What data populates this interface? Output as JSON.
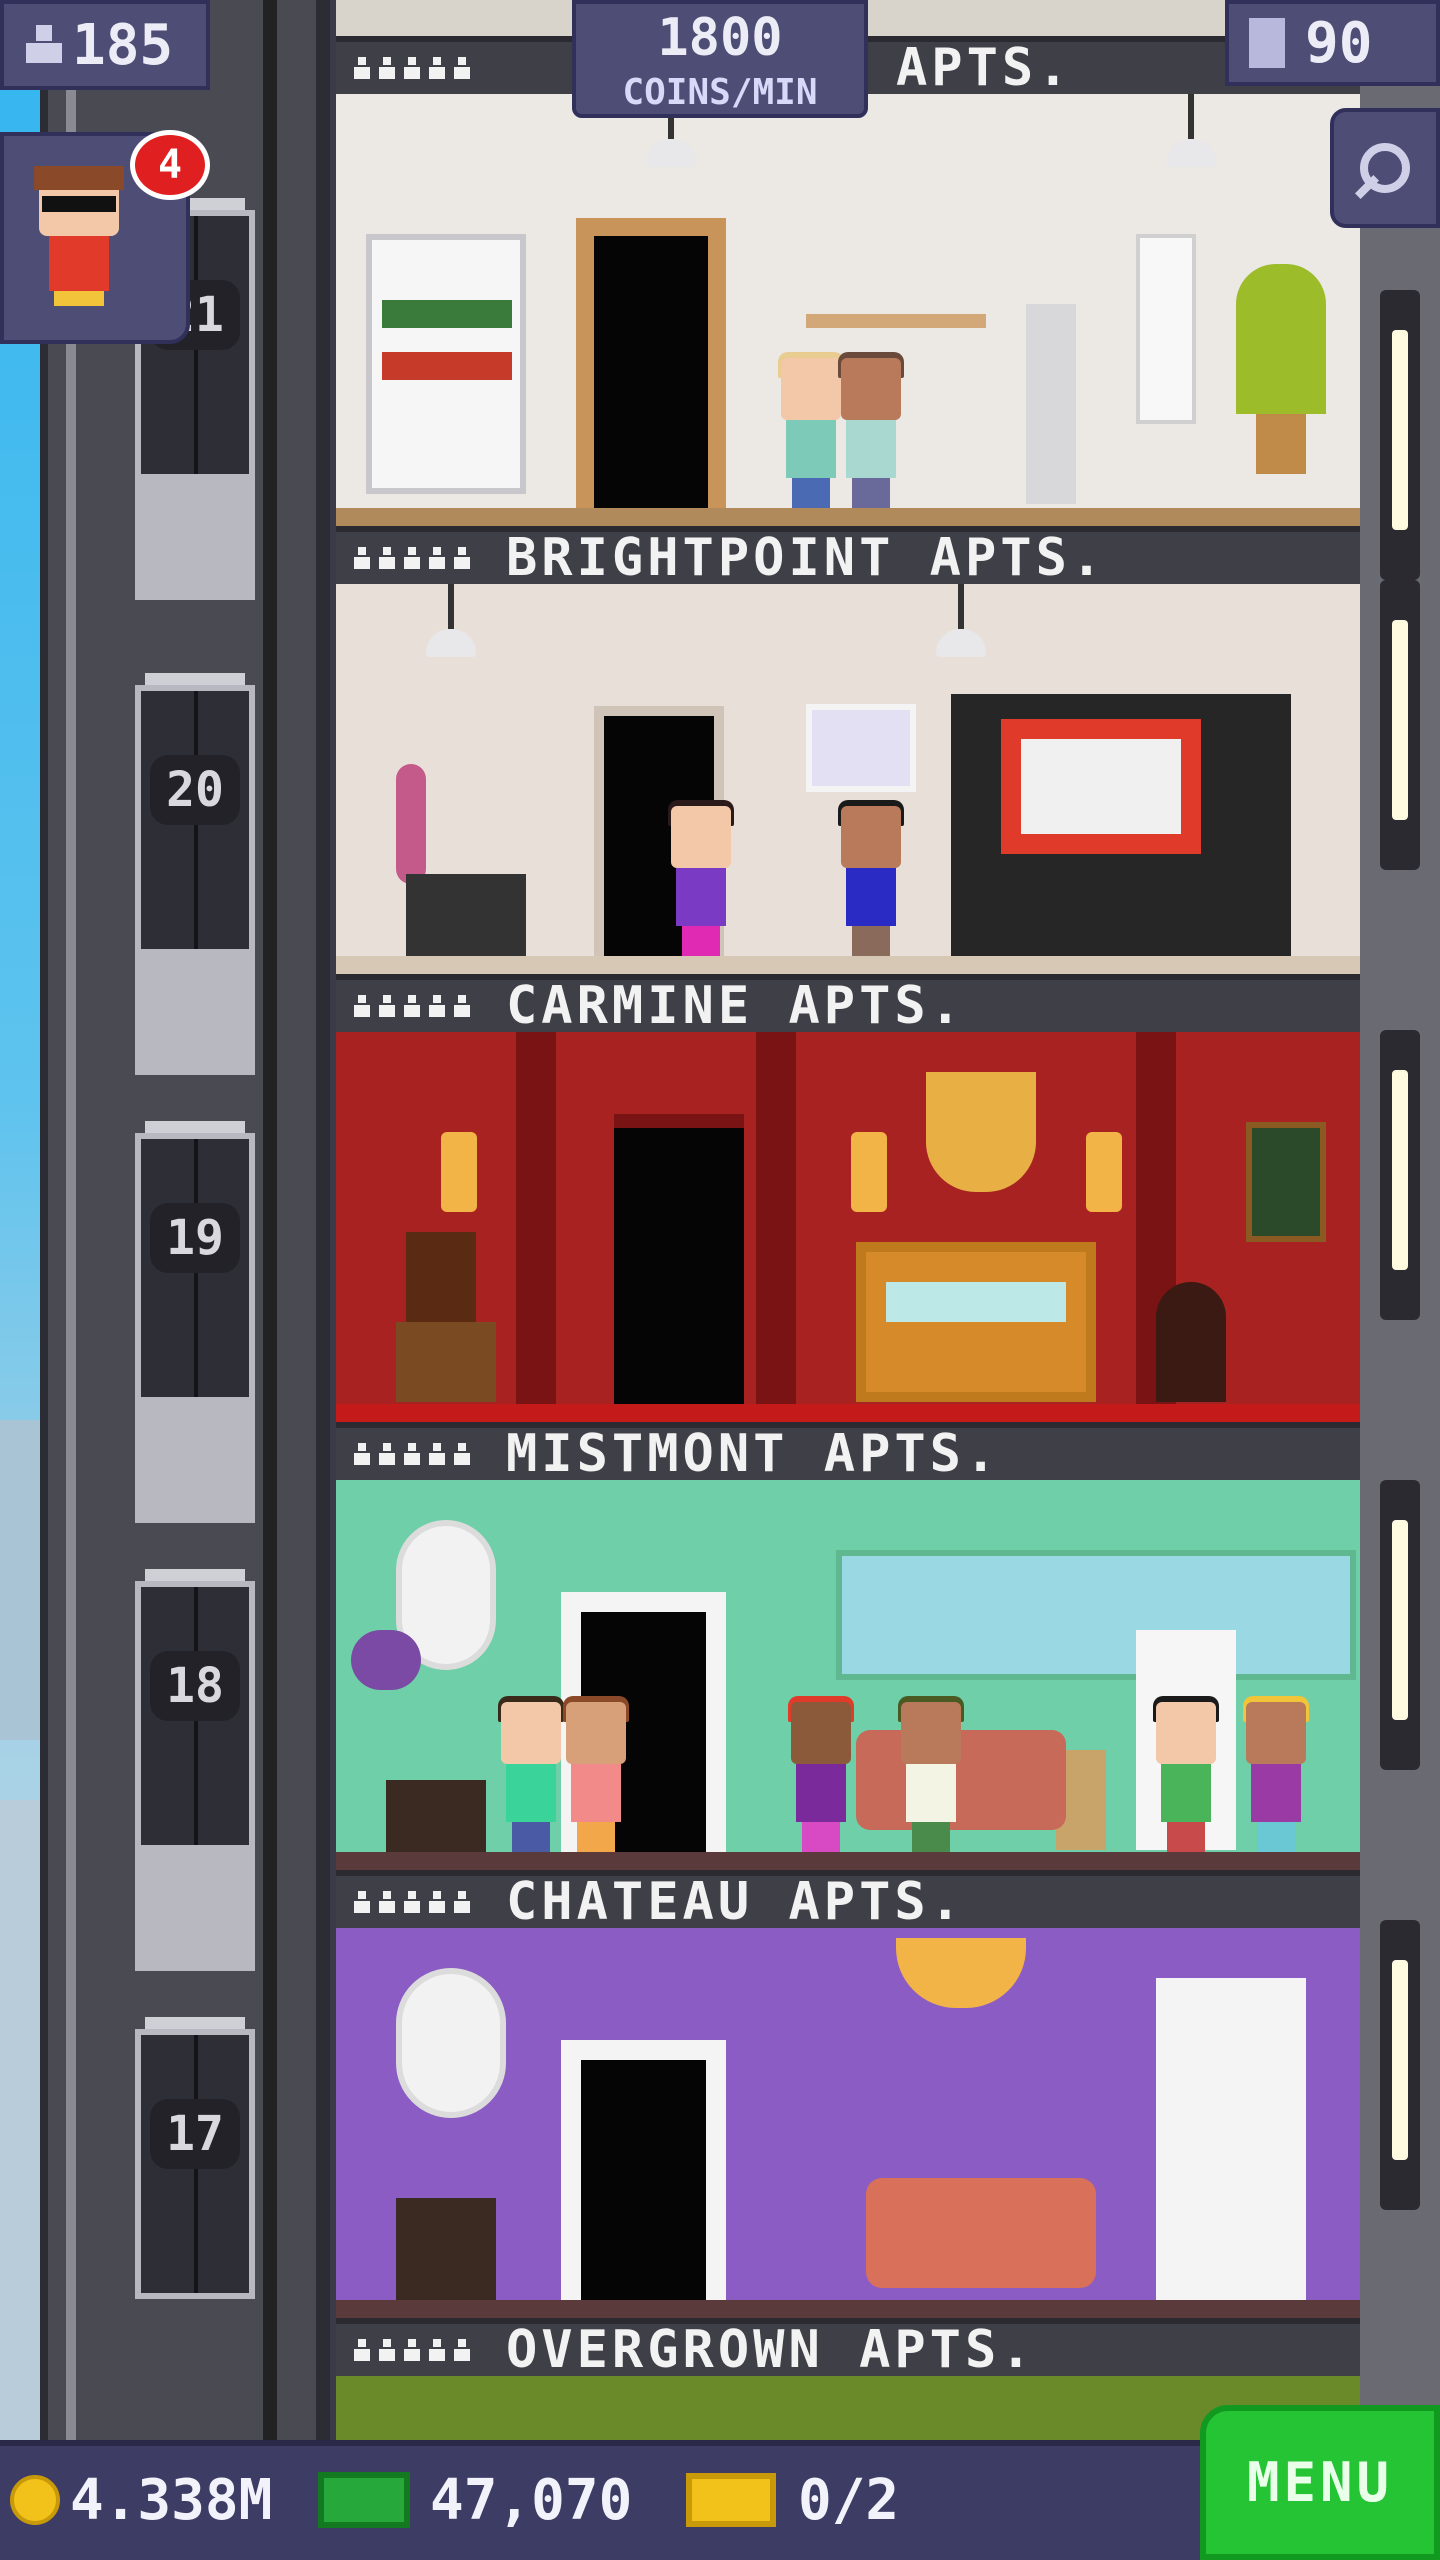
{
  "top_hud": {
    "population": "185",
    "coins_rate_value": "1800",
    "coins_rate_unit": "COINS/MIN",
    "floors_count": "90"
  },
  "notification": {
    "badge_count": "4"
  },
  "elevator": {
    "floor_numbers": [
      "21",
      "20",
      "19",
      "18",
      "17"
    ]
  },
  "floors": [
    {
      "name": "BRIGHTPOINT APTS.",
      "theme_color": "#ece8e4"
    },
    {
      "name": "CARMINE APTS.",
      "theme_color": "#e8e0d8"
    },
    {
      "name": "MISTMONT APTS.",
      "theme_color": "#a82222"
    },
    {
      "name": "CHATEAU APTS.",
      "theme_color": "#6ecfa8"
    },
    {
      "name": "OVERGROWN APTS.",
      "theme_color": "#8a5cc4"
    }
  ],
  "partial_top_floor_name": "APTS.",
  "bottom_hud": {
    "coins": "4.338M",
    "bux": "47,070",
    "tickets": "0/2",
    "menu_label": "MENU"
  },
  "colors": {
    "hud_bg": "#4d4d76",
    "menu_green": "#24c434",
    "badge_red": "#e02020",
    "coin_gold": "#f2c21a",
    "bux_green": "#26a83a"
  },
  "icons": [
    "population-icon",
    "floors-icon",
    "search-icon",
    "coin-icon",
    "bux-icon",
    "ticket-icon"
  ]
}
